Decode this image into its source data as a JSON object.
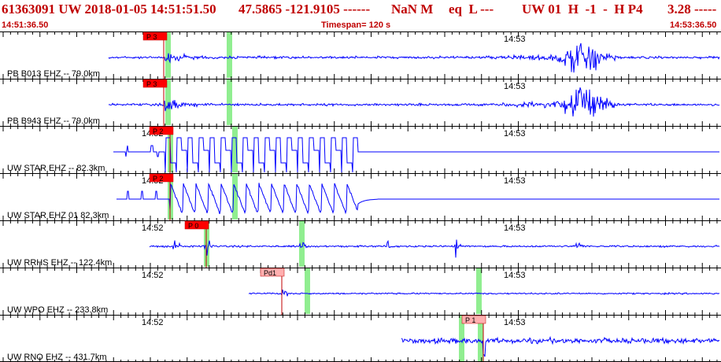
{
  "header": {
    "event_id": "61363091 UW 2018-01-05 14:51:51.50",
    "location": "47.5865 -121.9105 ------",
    "magnitude": "NaN M",
    "event_type": "eq  L ---",
    "solution": "UW 01  H  -1  -  H P4",
    "rms": "3.28 -----",
    "start_time": "14:51:36.50",
    "timespan": "Timespan= 120 s",
    "end_time": "14:53:36.50"
  },
  "colors": {
    "trace": "#0000ff",
    "text_red": "#c00000",
    "pick_label_bg": "#ff0000",
    "pick_label_light_bg": "#ffb0b0",
    "window_green": "#90ee90",
    "tick": "#000000"
  },
  "channels": [
    {
      "label": "PB B013 EHZ -- 79.0km",
      "time_labels": [
        "14:53"
      ],
      "pick_label": "P 3",
      "pick_style": "red",
      "signal": "tremor",
      "amplitude": 1.0
    },
    {
      "label": "PB B943 EHZ -- 79.0km",
      "time_labels": [
        "14:53"
      ],
      "pick_label": "P 3",
      "pick_style": "red",
      "signal": "tremor",
      "amplitude": 1.0
    },
    {
      "label": "UW STAR EHZ -- 82.3km",
      "time_labels": [
        "14:52",
        "14:53"
      ],
      "pick_label": "P 2",
      "pick_style": "red",
      "signal": "square",
      "amplitude": 1.0
    },
    {
      "label": "UW STAR EHZ 01 82.3km",
      "time_labels": [
        "14:52",
        "14:53"
      ],
      "pick_label": "P 2",
      "pick_style": "red",
      "signal": "sawtooth",
      "amplitude": 1.0
    },
    {
      "label": "UW RRHS EHZ -- 122.4km",
      "time_labels": [
        "14:52",
        "14:53"
      ],
      "pick_label": "P 0",
      "pick_style": "red",
      "signal": "spikes",
      "amplitude": 1.0
    },
    {
      "label": "UW WPO EHZ -- 233.8km",
      "time_labels": [
        "14:52",
        "14:53"
      ],
      "pick_label": "Pd1",
      "pick_style": "light",
      "signal": "quiet",
      "amplitude": 1.0
    },
    {
      "label": "UW RNO EHZ -- 431.7km",
      "time_labels": [
        "14:52",
        "14:53"
      ],
      "pick_label": "P 1",
      "pick_style": "light",
      "signal": "late",
      "amplitude": 1.0
    }
  ]
}
